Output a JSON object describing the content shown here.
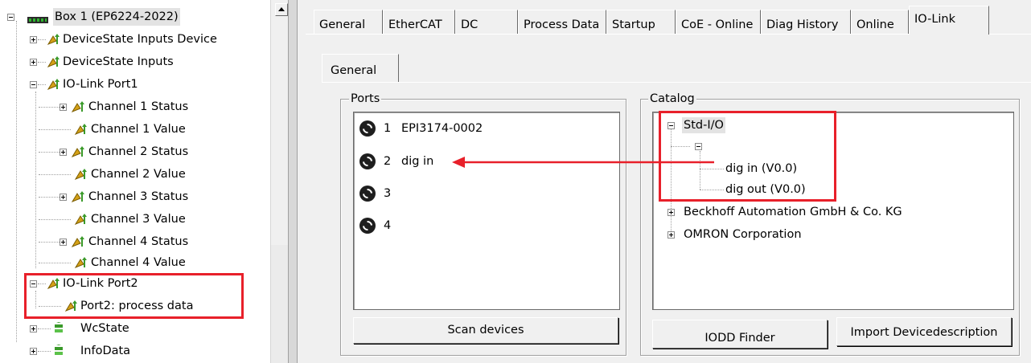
{
  "tree": {
    "root": "Box 1 (EP6224-2022)",
    "items": [
      {
        "label": "DeviceState Inputs Device"
      },
      {
        "label": "DeviceState Inputs"
      },
      {
        "label": "IO-Link Port1"
      },
      {
        "label": "Channel 1 Status"
      },
      {
        "label": "Channel 1 Value"
      },
      {
        "label": "Channel 2 Status"
      },
      {
        "label": "Channel 2 Value"
      },
      {
        "label": "Channel 3 Status"
      },
      {
        "label": "Channel 3 Value"
      },
      {
        "label": "Channel 4 Status"
      },
      {
        "label": "Channel 4 Value"
      },
      {
        "label": "IO-Link Port2"
      },
      {
        "label": "Port2: process data"
      },
      {
        "label": "WcState"
      },
      {
        "label": "InfoData"
      }
    ]
  },
  "tabs": [
    "General",
    "EtherCAT",
    "DC",
    "Process Data",
    "Startup",
    "CoE - Online",
    "Diag History",
    "Online",
    "IO-Link"
  ],
  "active_tab": "IO-Link",
  "subtab": "General",
  "ports": {
    "title": "Ports",
    "items": [
      {
        "num": "1",
        "name": "EPI3174-0002"
      },
      {
        "num": "2",
        "name": "dig in"
      },
      {
        "num": "3",
        "name": ""
      },
      {
        "num": "4",
        "name": ""
      }
    ],
    "scan_button": "Scan devices"
  },
  "catalog": {
    "title": "Catalog",
    "root": "Std-I/O",
    "items": [
      "dig in (V0.0)",
      "dig out (V0.0)"
    ],
    "vendors": [
      "Beckhoff Automation GmbH & Co. KG",
      "OMRON Corporation"
    ],
    "iodd_button": "IODD Finder",
    "import_button": "Import Devicedescription"
  },
  "colors": {
    "highlight": "#e8202a",
    "icon_gold": "#d4a017",
    "icon_green": "#3a9a2a"
  }
}
